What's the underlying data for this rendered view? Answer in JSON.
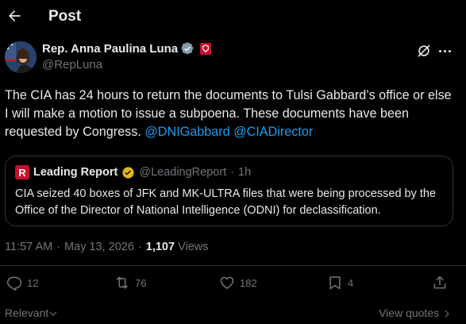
{
  "header": {
    "title": "Post"
  },
  "author": {
    "name": "Rep. Anna Paulina Luna",
    "handle": "@RepLuna"
  },
  "post": {
    "text": "The CIA has 24 hours to return the documents to Tulsi Gabbard’s office or else I will make a motion to issue a subpoena. These documents have been requested by Congress.",
    "mention1": "@DNIGabbard",
    "mention2": "@CIADirector"
  },
  "quote": {
    "logo_letter": "R",
    "name": "Leading Report",
    "handle": "@LeadingReport",
    "separator": "·",
    "time": "1h",
    "text": "CIA seized 40 boxes of JFK and MK-ULTRA files that were being processed by the Office of the Director of National Intelligence (ODNI) for declassification."
  },
  "meta": {
    "time": "11:57 AM",
    "sep1": "·",
    "date": "May 13, 2026",
    "sep2": "·",
    "views_count": "1,107",
    "views_label": "Views"
  },
  "actions": {
    "replies": "12",
    "reposts": "76",
    "likes": "182",
    "bookmarks": "4"
  },
  "footer": {
    "sort_label": "Relevant",
    "view_quotes": "View quotes"
  },
  "colors": {
    "background": "#000000",
    "text": "#e7e9ea",
    "secondary": "#71767b",
    "link": "#1d9bf0",
    "border": "#2f3336",
    "verified_gray": "#829aab",
    "verified_gold": "#e2b719",
    "badge_red": "#c8102e"
  },
  "icons": {
    "back": "arrow-left-icon",
    "grok": "grok-icon",
    "more": "more-horizontal-icon",
    "reply": "reply-icon",
    "repost": "repost-icon",
    "like": "heart-icon",
    "bookmark": "bookmark-icon",
    "share": "share-icon"
  }
}
